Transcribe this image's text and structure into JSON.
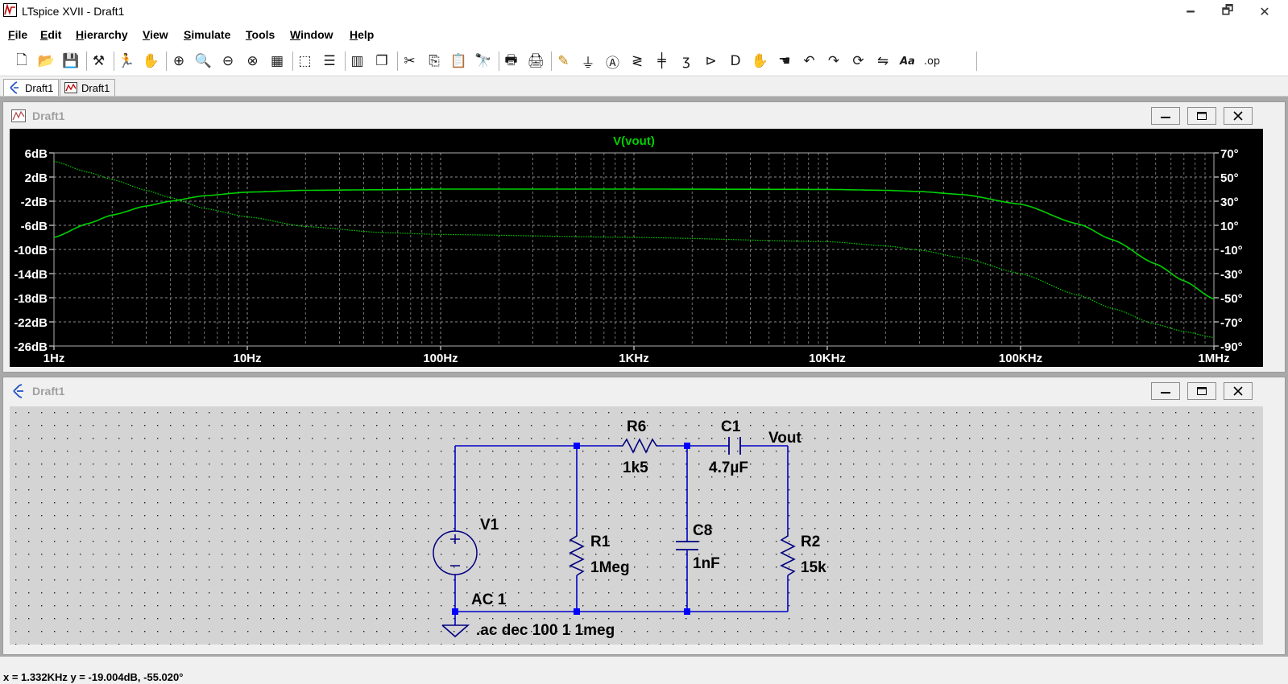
{
  "app": {
    "title": "LTspice XVII - Draft1"
  },
  "window_controls": {
    "minimize": "🗕",
    "restore": "🗗",
    "close": "✕"
  },
  "menu": [
    {
      "label": "File",
      "u": "F",
      "rest": "ile"
    },
    {
      "label": "Edit",
      "u": "E",
      "rest": "dit"
    },
    {
      "label": "Hierarchy",
      "u": "H",
      "rest": "ierarchy"
    },
    {
      "label": "View",
      "u": "V",
      "rest": "iew"
    },
    {
      "label": "Simulate",
      "u": "S",
      "rest": "imulate"
    },
    {
      "label": "Tools",
      "u": "T",
      "rest": "ools"
    },
    {
      "label": "Window",
      "u": "W",
      "rest": "indow"
    },
    {
      "label": "Help",
      "u": "H",
      "rest": "elp"
    }
  ],
  "toolbar": {
    "icons": [
      "new-schematic-icon",
      "open-icon",
      "save-icon",
      "control-panel-icon",
      "run-icon",
      "halt-icon",
      "zoom-in-icon",
      "pan-icon",
      "zoom-out-icon",
      "zoom-cancel-icon",
      "autorange-icon",
      "zoom-to-fit-icon",
      "tile-horizontal-icon",
      "tile-vertical-icon",
      "cascade-icon",
      "cut-icon",
      "copy-icon",
      "paste-icon",
      "find-icon",
      "print-setup-icon",
      "print-icon",
      "draw-wire-icon",
      "ground-icon",
      "label-net-icon",
      "resistor-icon",
      "capacitor-icon",
      "inductor-icon",
      "diode-icon",
      "component-icon",
      "move-icon",
      "drag-icon",
      "undo-icon",
      "redo-icon",
      "rotate-icon",
      "mirror-icon",
      "text-icon",
      "spice-directive-icon"
    ],
    "text_label": "Aa",
    "op_label": ".op"
  },
  "tabs": [
    {
      "label": "Draft1",
      "icon": "schematic-icon"
    },
    {
      "label": "Draft1",
      "icon": "waveform-icon"
    }
  ],
  "waveform_window": {
    "title": "Draft1",
    "trace_name": "V(vout)",
    "colors": {
      "background": "#000000",
      "trace": "#00d000",
      "grid": "#8c8c8c",
      "text": "#ffffff"
    }
  },
  "chart_data": {
    "type": "line",
    "title": "V(vout)",
    "x_scale": "log",
    "xlim": [
      1,
      1000000
    ],
    "x_tick_labels": [
      "1Hz",
      "10Hz",
      "100Hz",
      "1KHz",
      "10KHz",
      "100KHz",
      "1MHz"
    ],
    "ylim_left": [
      -26,
      6
    ],
    "y_left_tick_labels": [
      "6dB",
      "2dB",
      "-2dB",
      "-6dB",
      "-10dB",
      "-14dB",
      "-18dB",
      "-22dB",
      "-26dB"
    ],
    "ylim_right": [
      -90,
      70
    ],
    "y_right_tick_labels": [
      "70°",
      "50°",
      "30°",
      "10°",
      "-10°",
      "-30°",
      "-50°",
      "-70°",
      "-90°"
    ],
    "grid": true,
    "series": [
      {
        "name": "magnitude",
        "style": "solid",
        "x": [
          1,
          1.5,
          2,
          3,
          4,
          6,
          10,
          20,
          50,
          100,
          1000,
          10000,
          20000,
          30000,
          50000,
          100000,
          200000,
          300000,
          500000,
          700000,
          1000000
        ],
        "y": [
          -8.0,
          -5.7,
          -4.3,
          -2.8,
          -2.0,
          -1.1,
          -0.5,
          -0.2,
          -0.1,
          0.0,
          0.0,
          -0.05,
          -0.2,
          -0.4,
          -0.9,
          -2.5,
          -5.8,
          -8.4,
          -12.4,
          -15.2,
          -18.2
        ]
      },
      {
        "name": "phase",
        "style": "dotted",
        "x": [
          1,
          1.5,
          2,
          3,
          4,
          6,
          10,
          20,
          50,
          100,
          1000,
          10000,
          20000,
          30000,
          50000,
          100000,
          200000,
          300000,
          500000,
          700000,
          1000000
        ],
        "y": [
          63,
          54,
          48,
          39,
          33,
          24,
          17,
          9,
          4,
          2.4,
          0,
          -3.5,
          -7,
          -10.5,
          -17,
          -30,
          -48,
          -59,
          -72,
          -78,
          -83
        ]
      }
    ]
  },
  "schematic_window": {
    "title": "Draft1",
    "components": {
      "r6": {
        "name": "R6",
        "value": "1k5"
      },
      "c1": {
        "name": "C1",
        "value": "4.7µF"
      },
      "v1": {
        "name": "V1",
        "value": "AC 1"
      },
      "r1": {
        "name": "R1",
        "value": "1Meg"
      },
      "c8": {
        "name": "C8",
        "value": "1nF"
      },
      "r2": {
        "name": "R2",
        "value": "15k"
      }
    },
    "net_label": "Vout",
    "directive": ".ac dec 100 1 1meg",
    "colors": {
      "wire": "#0000c8",
      "component": "#000080",
      "junction": "#0000ff",
      "text": "#000000",
      "background": "#d4d4d4"
    }
  },
  "status_bar": {
    "text": "x = 1.332KHz    y = -19.004dB, -55.020°"
  }
}
